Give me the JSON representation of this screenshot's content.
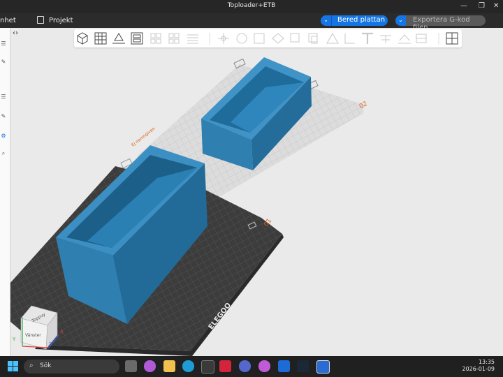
{
  "window": {
    "title": "Toploader+ETB"
  },
  "menu": {
    "left_item": "nhet",
    "project_label": "Projekt"
  },
  "actions": {
    "slice_label": "Bered plattan",
    "export_label": "Exportera G-kod filen"
  },
  "plates": {
    "plate1_number": "01",
    "plate2_number": "02",
    "unnamed_plate_label": "Ej namngiven"
  },
  "bed_brand": "ELEGOO",
  "view_cube": {
    "top_label": "Toppvy",
    "front_label": "Vänster"
  },
  "axes": {
    "x": "X",
    "y": "Y",
    "z": "Z"
  },
  "taskbar": {
    "search_label": "Sök",
    "time": "13:35",
    "date": "2026-01-09"
  },
  "colors": {
    "accent": "#1576e3",
    "model": "#2f7fb0",
    "bed_dark": "#3a3a3a",
    "plate_ghost": "#d9d9d9"
  }
}
